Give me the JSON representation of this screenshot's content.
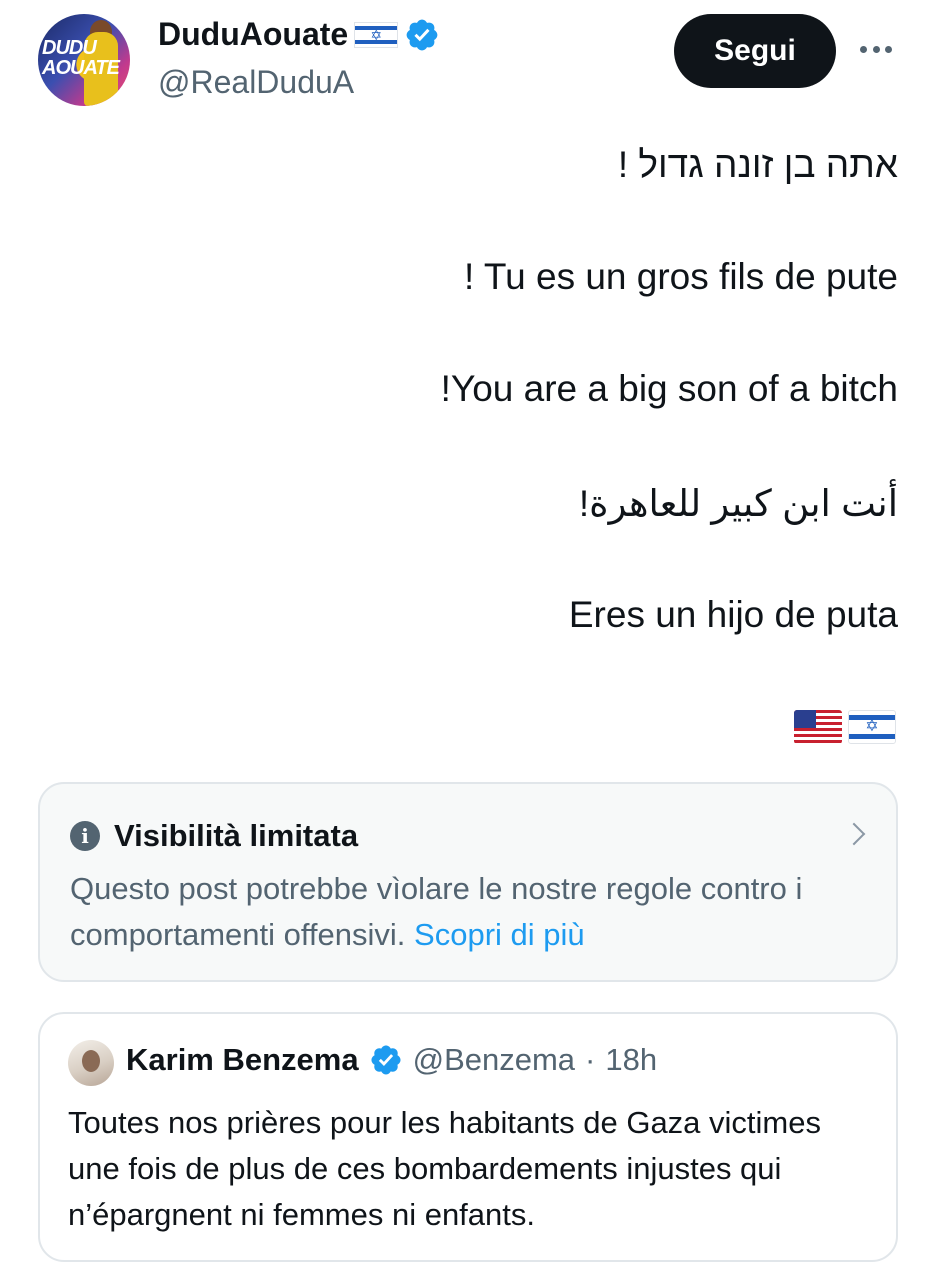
{
  "author": {
    "display_name": "DuduAouate",
    "name_flag": "israel-flag",
    "handle": "@RealDuduA",
    "avatar_text": "DUDU\nAOUATE",
    "verified": true
  },
  "actions": {
    "follow_label": "Segui",
    "more_icon": "more-horizontal-icon"
  },
  "post": {
    "lines": [
      "אתה בן זונה גדול !",
      "! Tu es un gros fils de pute",
      "!You are a big son of a bitch",
      "أنت ابن كبير للعاهرة!",
      "Eres un hijo de puta"
    ],
    "flags": [
      "us-flag",
      "israel-flag"
    ]
  },
  "notice": {
    "title": "Visibilità limitata",
    "body": "Questo post potrebbe vìolare le nostre regole contro i comportamenti offensivi.",
    "link": "Scopri di più"
  },
  "quote": {
    "name": "Karim Benzema",
    "handle": "@Benzema",
    "separator": "·",
    "time": "18h",
    "text": "Toutes nos prières pour les habitants de Gaza victimes une fois de plus de ces bombardements injustes qui n’épargnent ni femmes ni enfants."
  },
  "colors": {
    "verified_blue": "#1d9bf0",
    "link_blue": "#1d9bf0",
    "secondary_text": "#536471",
    "button_dark": "#0f1419"
  }
}
